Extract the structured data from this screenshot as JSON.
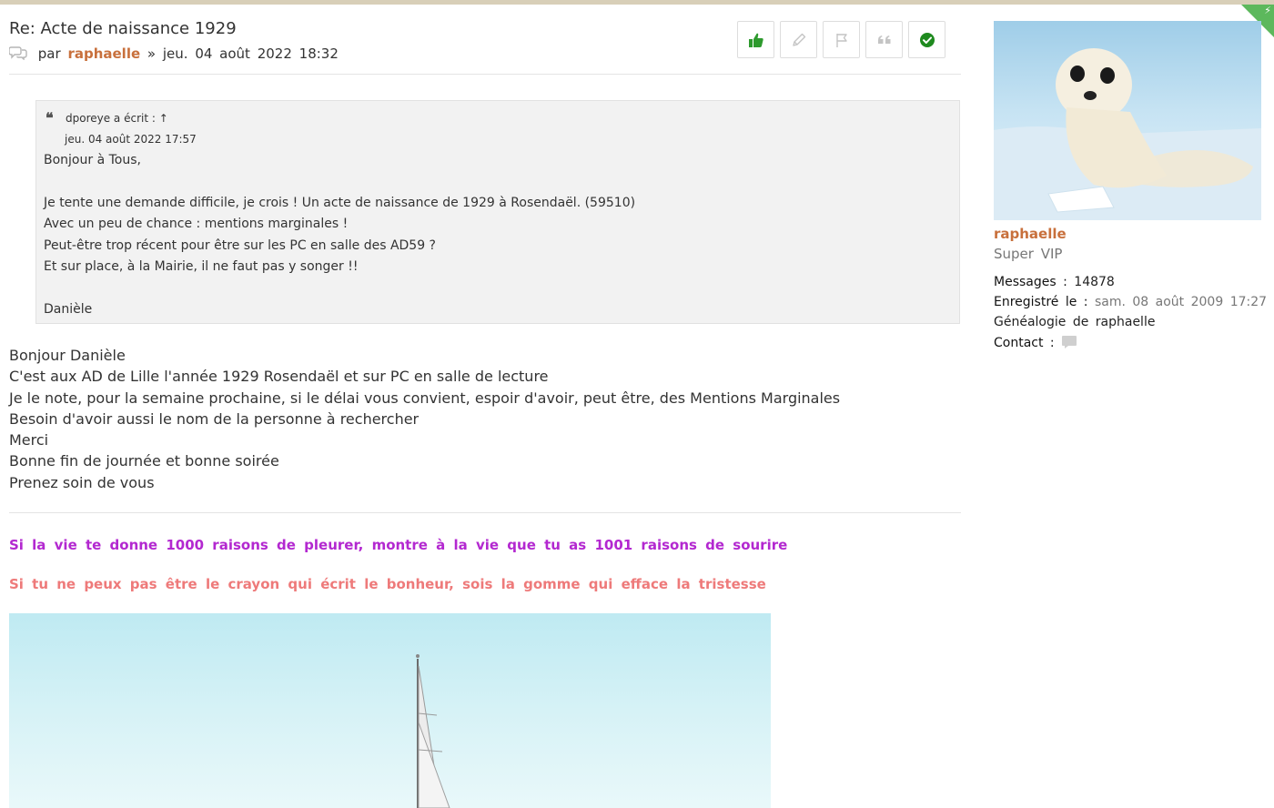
{
  "post": {
    "title": "Re: Acte de naissance 1929",
    "meta_prefix": "par",
    "author": "raphaelle",
    "separator": "»",
    "date": "jeu. 04 août 2022 18:32",
    "quote": {
      "author_text": "dporeye a écrit : ↑",
      "date": "jeu. 04 août 2022 17:57",
      "lines": [
        "Bonjour à Tous,",
        "",
        "Je tente une demande difficile, je crois ! Un acte de naissance de 1929 à Rosendaël. (59510)",
        "Avec un peu de chance : mentions marginales !",
        "Peut-être trop récent pour être sur les PC en salle des AD59 ?",
        "Et sur place, à la Mairie, il ne faut pas y songer !!",
        "",
        "Danièle"
      ]
    },
    "body_lines": [
      "Bonjour Danièle",
      "C'est aux AD de Lille l'année 1929 Rosendaël et sur PC en salle de lecture",
      "Je le note, pour la semaine prochaine, si le délai vous convient, espoir d'avoir, peut être, des Mentions Marginales",
      "Besoin d'avoir aussi le nom de la personne à rechercher",
      "Merci",
      "Bonne fin de journée et bonne soirée",
      "Prenez soin de vous"
    ],
    "signature": {
      "line1": "Si la vie te donne 1000 raisons de pleurer, montre à la vie que tu as 1001 raisons de sourire",
      "line2": "Si tu ne peux pas être le crayon qui écrit le bonheur, sois la gomme qui efface la tristesse"
    },
    "actions": [
      "like",
      "edit",
      "report",
      "quote",
      "solved"
    ]
  },
  "profile": {
    "username": "raphaelle",
    "rank": "Super VIP",
    "messages_label": "Messages :",
    "messages_value": "14878",
    "registered_label": "Enregistré le :",
    "registered_value": "sam. 08 août 2009 17:27",
    "genealogy": "Généalogie de raphaelle",
    "contact_label": "Contact :"
  },
  "colors": {
    "author": "#c8703c",
    "signature1": "#b328d0",
    "signature2": "#ee7a7a",
    "like_icon": "#2e9a2e",
    "solved_icon": "#1f8a1f",
    "corner": "#5cb85c"
  }
}
